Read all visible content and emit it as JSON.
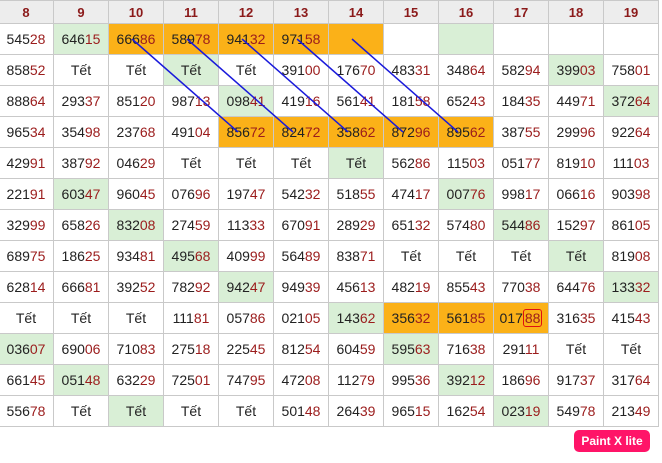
{
  "table": {
    "headers": [
      "8",
      "9",
      "10",
      "11",
      "12",
      "13",
      "14",
      "15",
      "16",
      "17",
      "18",
      "19"
    ],
    "rows": [
      [
        {
          "v": "54528"
        },
        {
          "v": "64615",
          "c": "g"
        },
        {
          "v": "66686",
          "c": "o"
        },
        {
          "v": "58978",
          "c": "o"
        },
        {
          "v": "94132",
          "c": "o"
        },
        {
          "v": "97158",
          "c": "o"
        },
        {
          "v": "",
          "c": "o"
        },
        {
          "v": ""
        },
        {
          "v": "",
          "c": "g"
        },
        {
          "v": ""
        },
        {
          "v": ""
        },
        {
          "v": ""
        }
      ],
      [
        {
          "v": "85852"
        },
        {
          "v": "Tết"
        },
        {
          "v": "Tết"
        },
        {
          "v": "Tết",
          "c": "g"
        },
        {
          "v": "Tết"
        },
        {
          "v": "39100"
        },
        {
          "v": "17670"
        },
        {
          "v": "48331"
        },
        {
          "v": "34864"
        },
        {
          "v": "58294"
        },
        {
          "v": "39903",
          "c": "g"
        },
        {
          "v": "75801"
        }
      ],
      [
        {
          "v": "88864"
        },
        {
          "v": "29337"
        },
        {
          "v": "85120"
        },
        {
          "v": "98713"
        },
        {
          "v": "09841",
          "c": "g"
        },
        {
          "v": "41916"
        },
        {
          "v": "56141"
        },
        {
          "v": "18158"
        },
        {
          "v": "65243"
        },
        {
          "v": "18435"
        },
        {
          "v": "44971"
        },
        {
          "v": "37264",
          "c": "g"
        }
      ],
      [
        {
          "v": "96534"
        },
        {
          "v": "35498"
        },
        {
          "v": "23768"
        },
        {
          "v": "49104"
        },
        {
          "v": "85672",
          "c": "o"
        },
        {
          "v": "82472",
          "c": "o"
        },
        {
          "v": "35862",
          "c": "o"
        },
        {
          "v": "87296",
          "c": "o"
        },
        {
          "v": "89562",
          "c": "o"
        },
        {
          "v": "38755"
        },
        {
          "v": "29996"
        },
        {
          "v": "92264"
        }
      ],
      [
        {
          "v": "42991"
        },
        {
          "v": "38792"
        },
        {
          "v": "04629"
        },
        {
          "v": "Tết"
        },
        {
          "v": "Tết"
        },
        {
          "v": "Tết"
        },
        {
          "v": "Tết",
          "c": "g"
        },
        {
          "v": "56286"
        },
        {
          "v": "11503"
        },
        {
          "v": "05177"
        },
        {
          "v": "81910"
        },
        {
          "v": "11103"
        }
      ],
      [
        {
          "v": "22191"
        },
        {
          "v": "60347",
          "c": "g"
        },
        {
          "v": "96045"
        },
        {
          "v": "07696"
        },
        {
          "v": "19747"
        },
        {
          "v": "54232"
        },
        {
          "v": "51855"
        },
        {
          "v": "47417"
        },
        {
          "v": "00776",
          "c": "g"
        },
        {
          "v": "99817"
        },
        {
          "v": "06616"
        },
        {
          "v": "90398"
        }
      ],
      [
        {
          "v": "32999"
        },
        {
          "v": "65826"
        },
        {
          "v": "83208",
          "c": "g"
        },
        {
          "v": "27459"
        },
        {
          "v": "11333"
        },
        {
          "v": "67091"
        },
        {
          "v": "28929"
        },
        {
          "v": "65132"
        },
        {
          "v": "57480"
        },
        {
          "v": "54486",
          "c": "g"
        },
        {
          "v": "15297"
        },
        {
          "v": "86105"
        }
      ],
      [
        {
          "v": "68975"
        },
        {
          "v": "18625"
        },
        {
          "v": "93481"
        },
        {
          "v": "49568",
          "c": "g"
        },
        {
          "v": "40999"
        },
        {
          "v": "56489"
        },
        {
          "v": "83871"
        },
        {
          "v": "Tết"
        },
        {
          "v": "Tết"
        },
        {
          "v": "Tết"
        },
        {
          "v": "Tết",
          "c": "g"
        },
        {
          "v": "81908"
        }
      ],
      [
        {
          "v": "62814"
        },
        {
          "v": "66681"
        },
        {
          "v": "39252"
        },
        {
          "v": "78292"
        },
        {
          "v": "94247",
          "c": "g"
        },
        {
          "v": "94939"
        },
        {
          "v": "45613"
        },
        {
          "v": "48219"
        },
        {
          "v": "85543"
        },
        {
          "v": "77038"
        },
        {
          "v": "64476"
        },
        {
          "v": "13332",
          "c": "g"
        }
      ],
      [
        {
          "v": "Tết"
        },
        {
          "v": "Tết"
        },
        {
          "v": "Tết"
        },
        {
          "v": "11181"
        },
        {
          "v": "05786"
        },
        {
          "v": "02105"
        },
        {
          "v": "14362",
          "c": "g"
        },
        {
          "v": "35632",
          "c": "o"
        },
        {
          "v": "56185",
          "c": "o"
        },
        {
          "v": "01788",
          "c": "o",
          "box": true
        },
        {
          "v": "31635"
        },
        {
          "v": "41543"
        }
      ],
      [
        {
          "v": "03607",
          "c": "g"
        },
        {
          "v": "69006"
        },
        {
          "v": "71083"
        },
        {
          "v": "27518"
        },
        {
          "v": "22545"
        },
        {
          "v": "81254"
        },
        {
          "v": "60459"
        },
        {
          "v": "59563",
          "c": "g"
        },
        {
          "v": "71638"
        },
        {
          "v": "29111"
        },
        {
          "v": "Tết"
        },
        {
          "v": "Tết"
        }
      ],
      [
        {
          "v": "66145"
        },
        {
          "v": "05148",
          "c": "g"
        },
        {
          "v": "63229"
        },
        {
          "v": "72501"
        },
        {
          "v": "74795"
        },
        {
          "v": "47208"
        },
        {
          "v": "11279"
        },
        {
          "v": "99536"
        },
        {
          "v": "39212",
          "c": "g"
        },
        {
          "v": "18696"
        },
        {
          "v": "91737"
        },
        {
          "v": "31764"
        }
      ],
      [
        {
          "v": "55678"
        },
        {
          "v": "Tết"
        },
        {
          "v": "Tết",
          "c": "g"
        },
        {
          "v": "Tết"
        },
        {
          "v": "Tết"
        },
        {
          "v": "50148"
        },
        {
          "v": "26439"
        },
        {
          "v": "96515"
        },
        {
          "v": "16254"
        },
        {
          "v": "02319",
          "c": "g"
        },
        {
          "v": "54978"
        },
        {
          "v": "21349"
        }
      ]
    ]
  },
  "arrows": [
    {
      "from": [
        0,
        2
      ],
      "to": [
        3,
        4
      ]
    },
    {
      "from": [
        0,
        3
      ],
      "to": [
        3,
        5
      ]
    },
    {
      "from": [
        0,
        4
      ],
      "to": [
        3,
        6
      ]
    },
    {
      "from": [
        0,
        5
      ],
      "to": [
        3,
        7
      ]
    },
    {
      "from": [
        0,
        6
      ],
      "to": [
        3,
        8
      ]
    }
  ],
  "colors": {
    "green": "#d9efd6",
    "orange": "#fbb118",
    "arrow": "#1a1adb",
    "number_accent": "#9b1c1c",
    "badge": "#ff1468"
  },
  "badge": {
    "label": "Paint X lite"
  }
}
